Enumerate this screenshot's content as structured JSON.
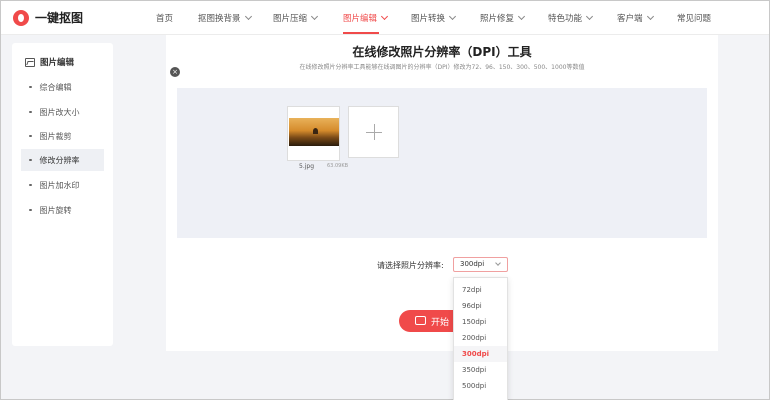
{
  "header": {
    "logo_text": "一键抠图",
    "nav": [
      {
        "label": "首页",
        "chevron": false
      },
      {
        "label": "抠图换背景",
        "chevron": true
      },
      {
        "label": "图片压缩",
        "chevron": true
      },
      {
        "label": "图片编辑",
        "chevron": true,
        "active": true
      },
      {
        "label": "图片转换",
        "chevron": true
      },
      {
        "label": "照片修复",
        "chevron": true
      },
      {
        "label": "特色功能",
        "chevron": true
      },
      {
        "label": "客户端",
        "chevron": true
      },
      {
        "label": "常见问题",
        "chevron": false
      }
    ]
  },
  "sidebar": {
    "title": "图片编辑",
    "items": [
      {
        "label": "综合编辑"
      },
      {
        "label": "图片改大小"
      },
      {
        "label": "图片裁剪"
      },
      {
        "label": "修改分辨率",
        "active": true
      },
      {
        "label": "图片加水印"
      },
      {
        "label": "图片旋转"
      }
    ]
  },
  "main": {
    "title": "在线修改照片分辨率（DPI）工具",
    "subtitle": "在线修改照片分辨率工具能够在线调图片的分辨率（DPI）修改为72、96、150、300、500、1000等数值",
    "file": {
      "name": "5.jpg",
      "size": "63.09KB"
    },
    "resolution_label": "请选择照片分辨率:",
    "resolution_value": "300dpi",
    "start_button": "开始",
    "remove_symbol": "×"
  },
  "dropdown": {
    "options": [
      "72dpi",
      "96dpi",
      "150dpi",
      "200dpi",
      "300dpi",
      "350dpi",
      "500dpi"
    ],
    "selected": "300dpi"
  },
  "colors": {
    "accent": "#f04a4a",
    "background": "#f3f4f7",
    "upload_area": "#eef0f6"
  }
}
